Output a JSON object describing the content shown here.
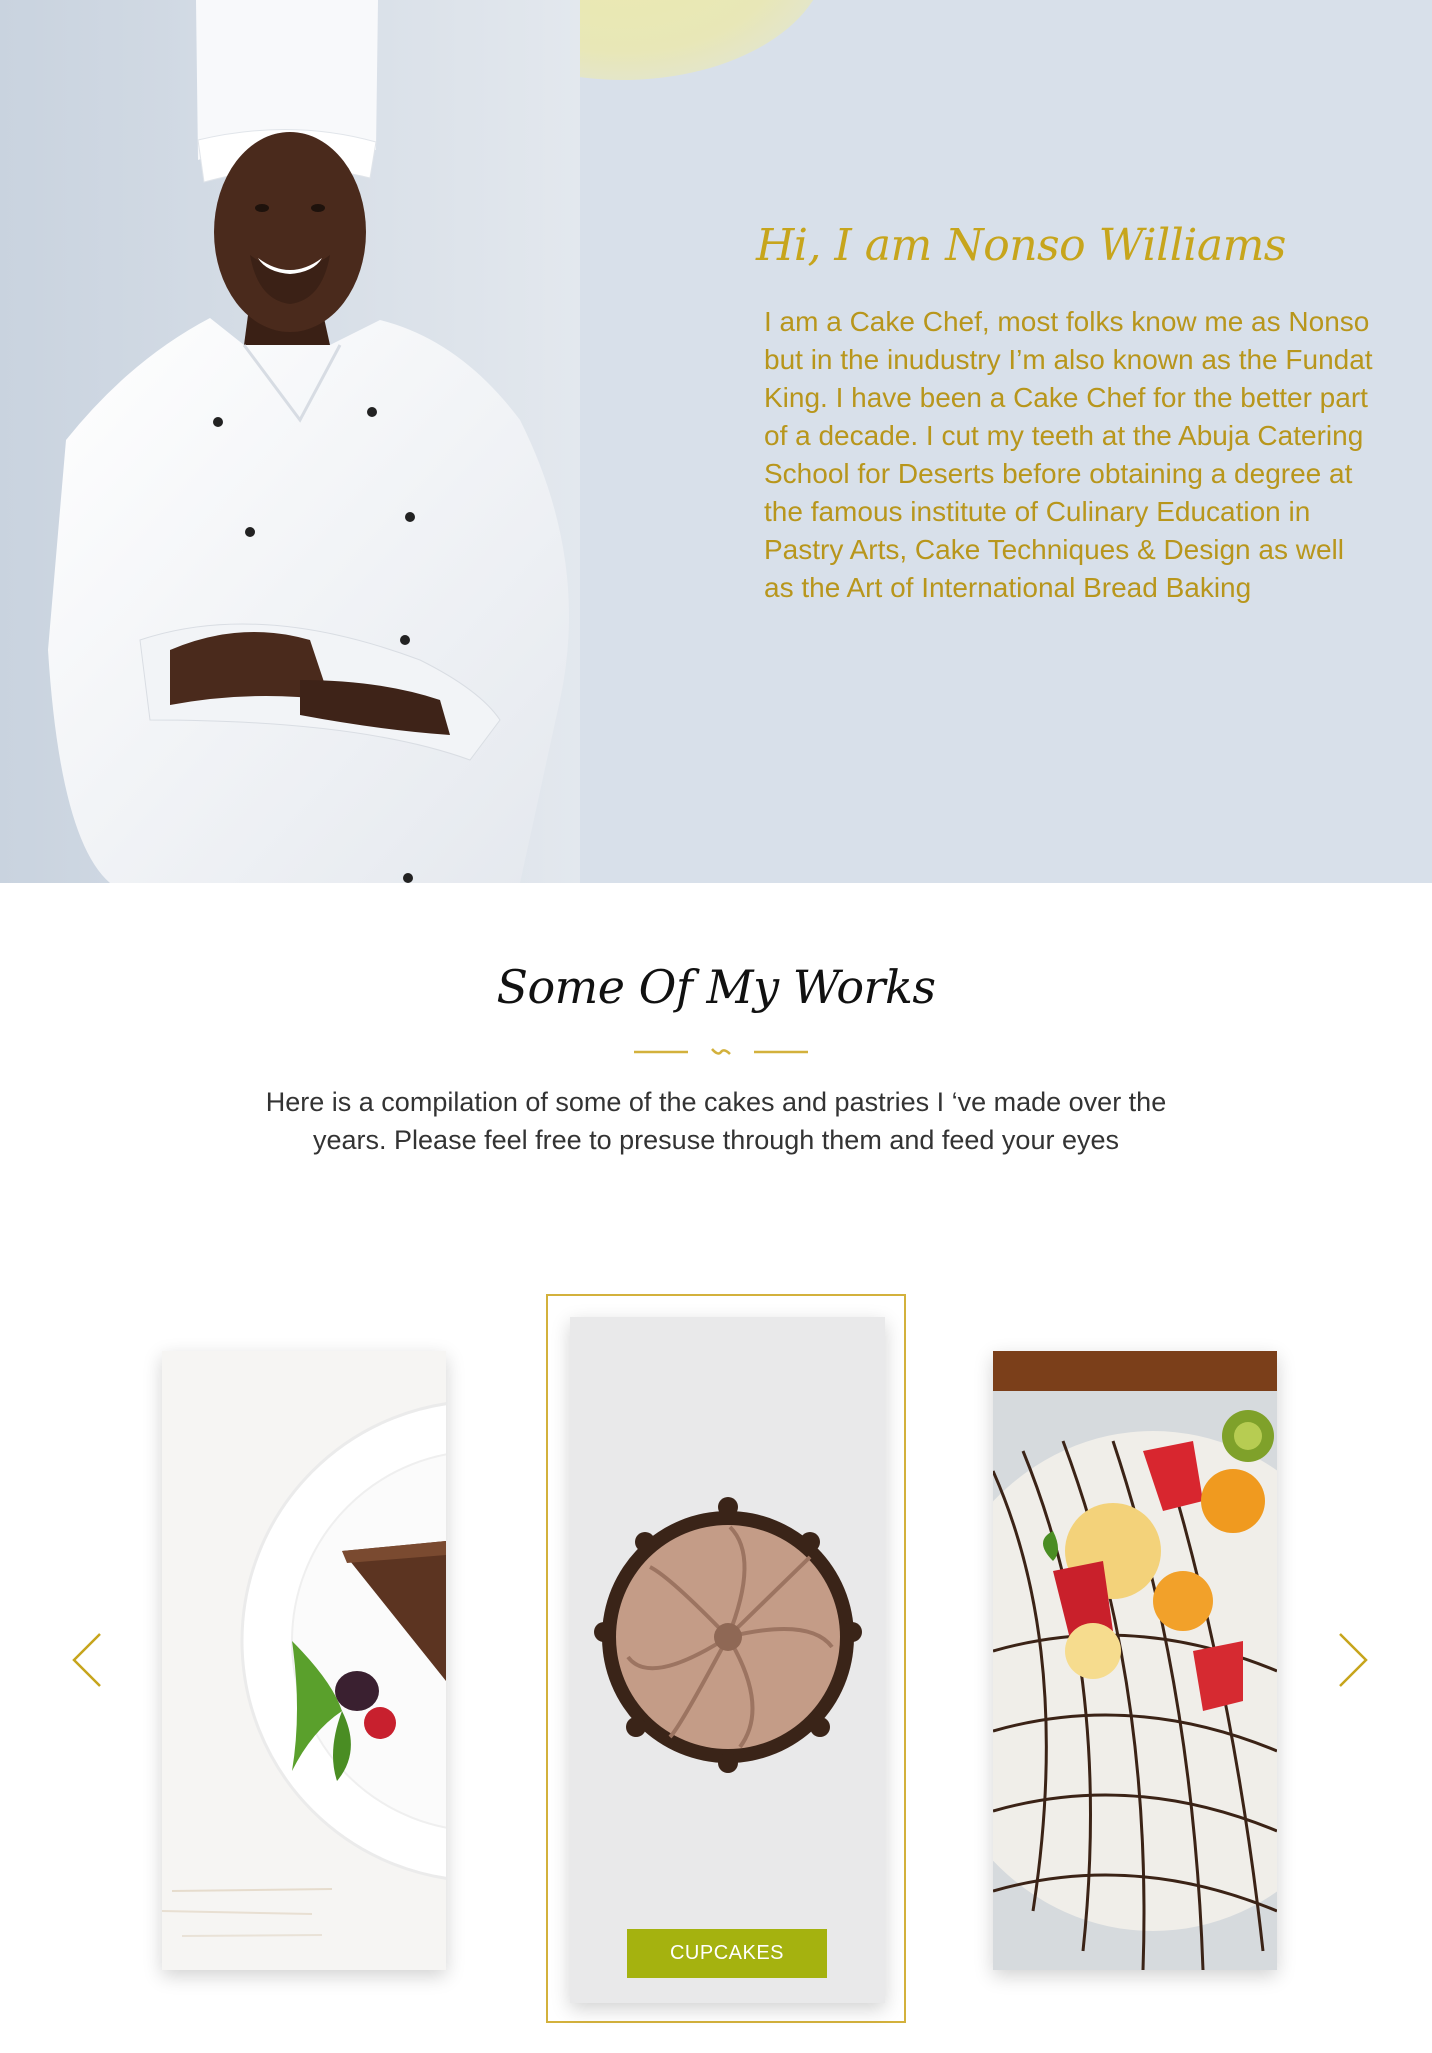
{
  "hero": {
    "title": "Hi, I am Nonso Williams",
    "bio": "I am a Cake Chef, most folks know me as Nonso but in the inudustry I’m also known as the Fundat King. I have been a Cake Chef for the better part of a decade. I cut my teeth at the Abuja Catering School for Deserts before obtaining a degree at the famous institute of Culinary Education in Pastry Arts, Cake Techniques & Design as well as the Art of International Bread Baking"
  },
  "works": {
    "title": "Some Of My Works",
    "description": "Here is a compilation of some of the cakes and pastries I ‘ve made  over the years. Please feel free to presuse through them and feed your eyes",
    "slides": [
      {
        "subject": "chocolate-tart-slice"
      },
      {
        "subject": "chocolate-cupcake",
        "label": "CUPCAKES",
        "active": true
      },
      {
        "subject": "fruit-topped-cake"
      }
    ]
  },
  "colors": {
    "accent_gold": "#c7a51c",
    "button_green": "#a5b20f",
    "hero_background": "#d8e0ea"
  },
  "icons": [
    "chevron-left-icon",
    "chevron-right-icon",
    "swirl-divider-icon"
  ]
}
